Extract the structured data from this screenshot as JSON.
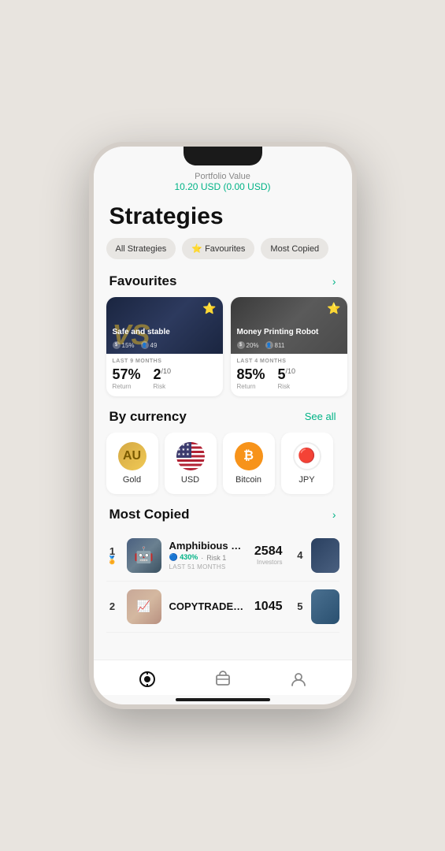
{
  "header": {
    "title": "Portfolio Value",
    "value": "10.20 USD",
    "change": "(0.00 USD)"
  },
  "page": {
    "title": "Strategies"
  },
  "filter_tabs": [
    {
      "label": "All Strategies",
      "active": false
    },
    {
      "label": "⭐ Favourites",
      "active": false
    },
    {
      "label": "Most Copied",
      "active": false
    }
  ],
  "favourites": {
    "section_title": "Favourites",
    "cards": [
      {
        "name": "Safe and stable",
        "return_pct": "15%",
        "investors": "49",
        "period": "LAST 9 MONTHS",
        "return_value": "57%",
        "risk_value": "2",
        "risk_max": "10",
        "return_label": "Return",
        "risk_label": "Risk"
      },
      {
        "name": "Money Printing Robot",
        "return_pct": "20%",
        "investors": "811",
        "period": "LAST 4 MONTHS",
        "return_value": "85%",
        "risk_value": "5",
        "risk_max": "10",
        "return_label": "Return",
        "risk_label": "Risk"
      }
    ]
  },
  "by_currency": {
    "section_title": "By currency",
    "see_all": "See all",
    "items": [
      {
        "id": "gold",
        "label": "Gold",
        "symbol": "AU"
      },
      {
        "id": "usd",
        "label": "USD",
        "symbol": "🇺🇸"
      },
      {
        "id": "bitcoin",
        "label": "Bitcoin",
        "symbol": "₿"
      },
      {
        "id": "jpy",
        "label": "JPY",
        "symbol": "🔴"
      }
    ]
  },
  "most_copied": {
    "section_title": "Most Copied",
    "rows": [
      {
        "rank": "1",
        "name": "Amphibious Robot Min",
        "return_pct": "430%",
        "risk": "1",
        "period": "LAST 51 MONTHS",
        "investors": "2584",
        "investors_label": "Investors",
        "rank_right": "4"
      },
      {
        "rank": "2",
        "name": "COPYTRADER ATC",
        "return_pct": "",
        "risk": "",
        "period": "",
        "investors": "1045",
        "investors_label": "",
        "rank_right": "5"
      }
    ]
  },
  "bottom_nav": {
    "items": [
      {
        "id": "strategies",
        "label": "",
        "active": true
      },
      {
        "id": "portfolio",
        "label": "",
        "active": false
      },
      {
        "id": "profile",
        "label": "",
        "active": false
      }
    ]
  }
}
